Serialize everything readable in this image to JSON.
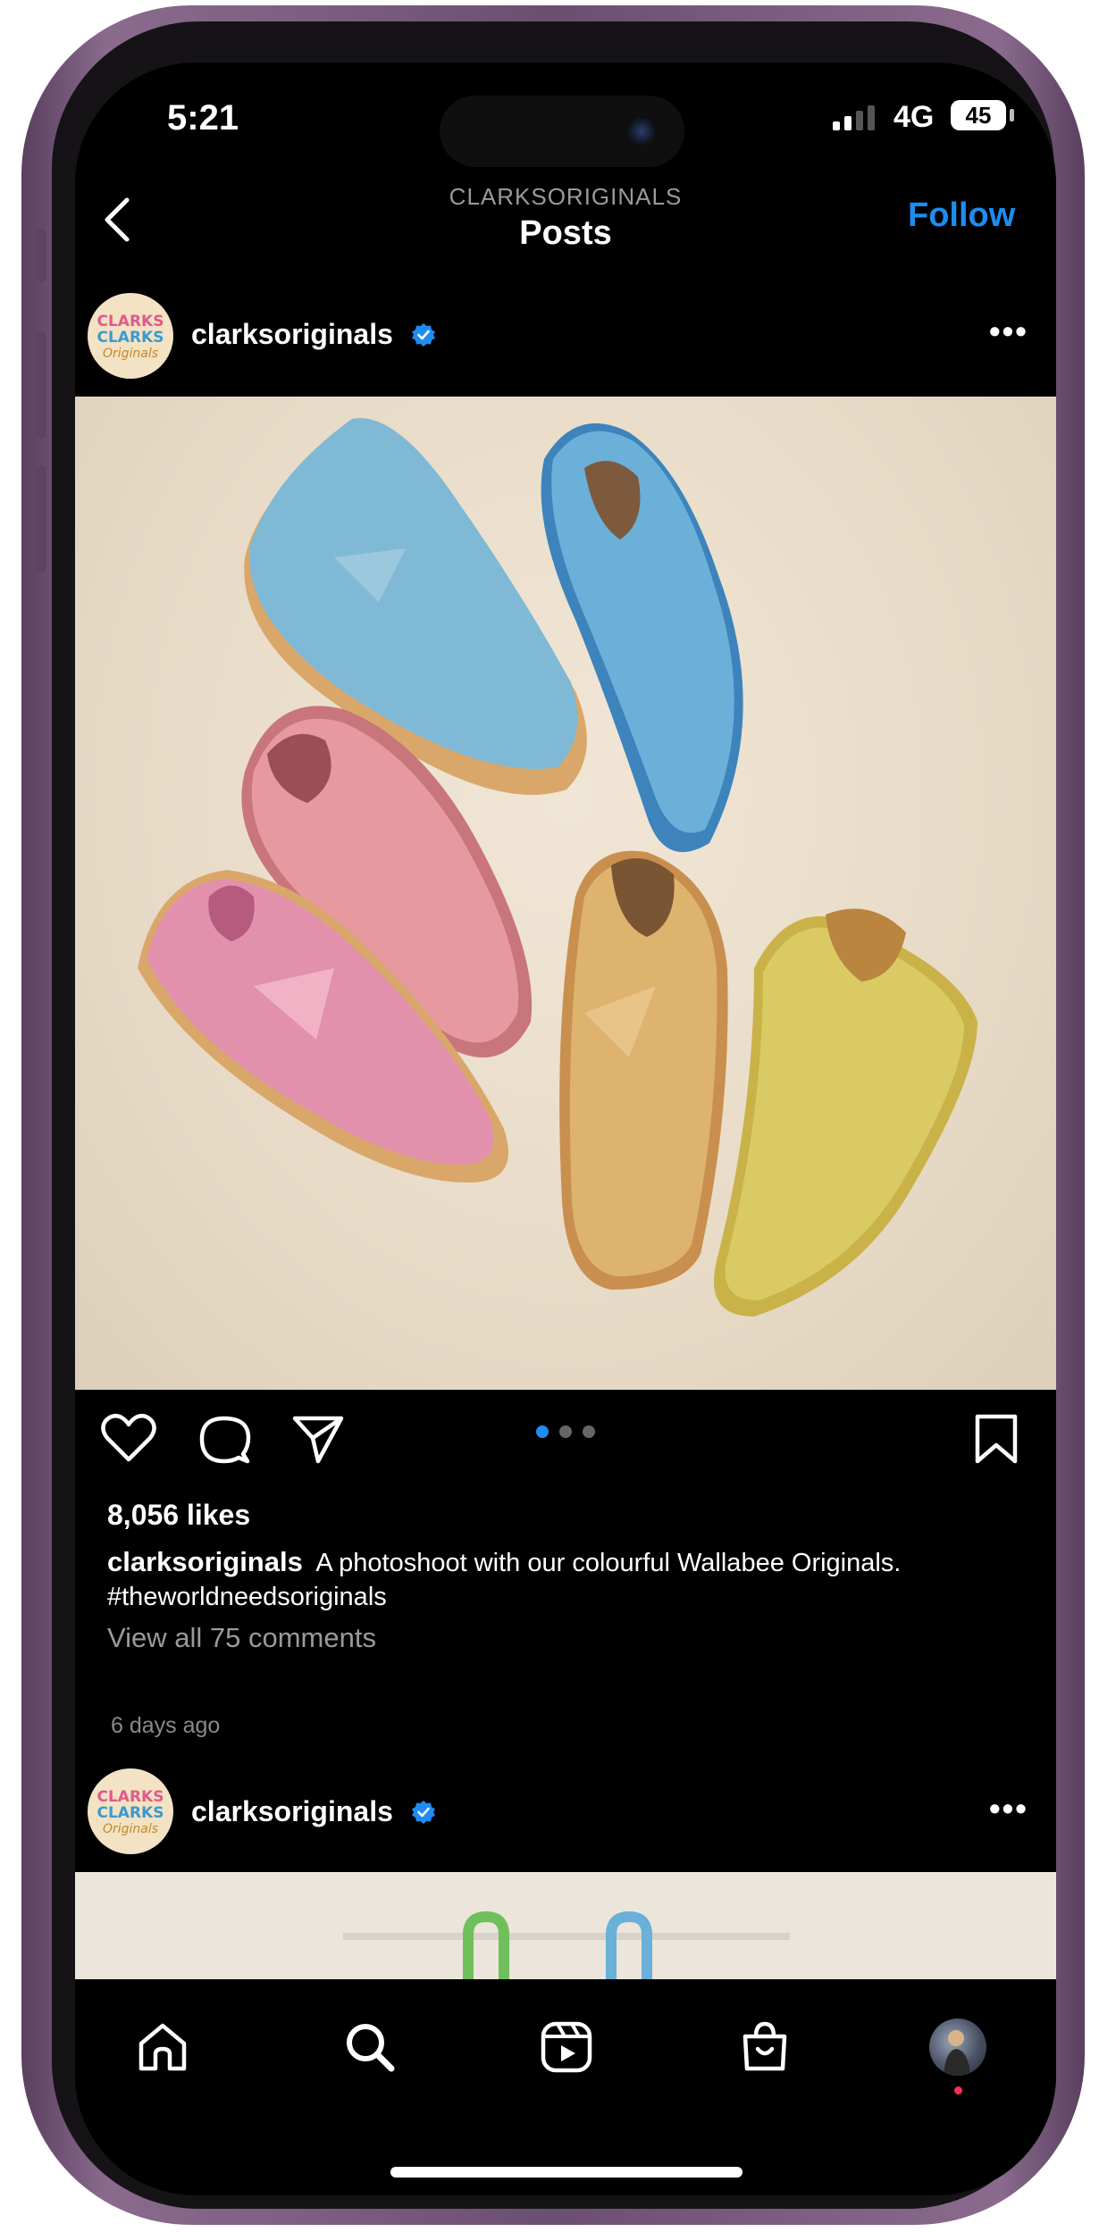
{
  "status_bar": {
    "time": "5:21",
    "network": "4G",
    "battery": "45"
  },
  "header": {
    "account": "CLARKSORIGINALS",
    "title": "Posts",
    "follow_label": "Follow"
  },
  "avatar_logo": {
    "line1": "CLARKS",
    "line2": "CLARKS",
    "line3": "Originals"
  },
  "post": {
    "username": "clarksoriginals",
    "likes": "8,056 likes",
    "caption_user": "clarksoriginals",
    "caption_text": "A photoshoot with our colourful Wallabee Originals.",
    "caption_hashtag": "#theworldneedsoriginals",
    "comments_link": "View all 75 comments",
    "timestamp": "6 days ago",
    "carousel_total": 3,
    "carousel_active": 1
  },
  "next_post": {
    "username": "clarksoriginals"
  },
  "tab_bar": {
    "items": [
      "home-icon",
      "search-icon",
      "reels-icon",
      "shop-icon",
      "profile-avatar"
    ]
  },
  "colors": {
    "accent": "#1e8cf0",
    "background": "#000000",
    "frame": "#6b4f70",
    "notification": "#ff2d55"
  }
}
